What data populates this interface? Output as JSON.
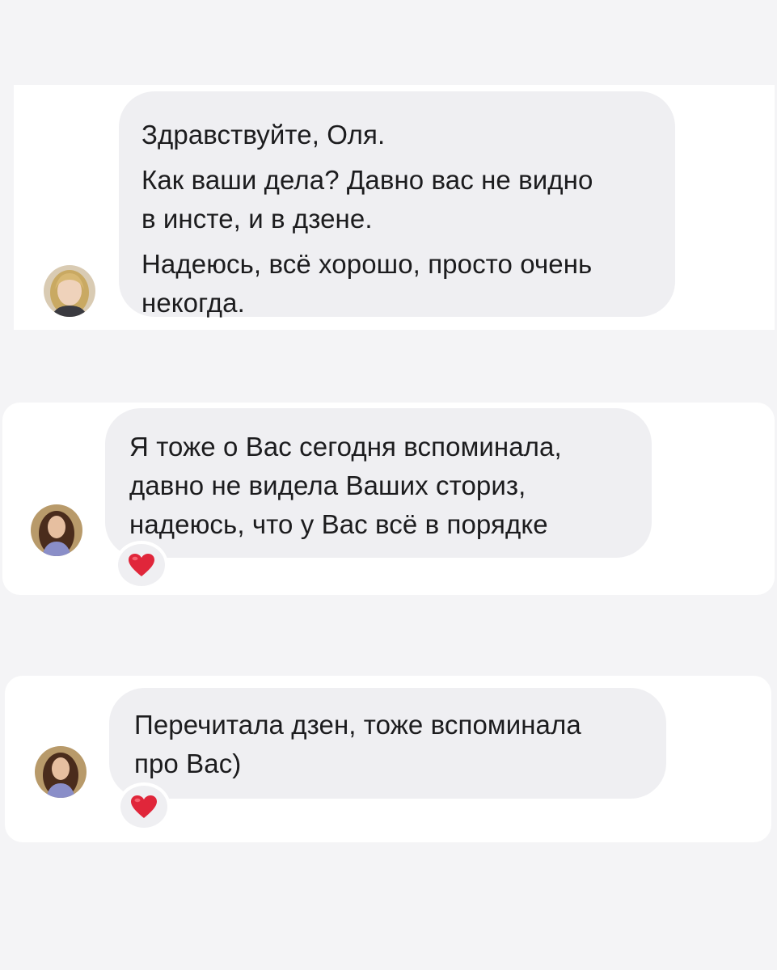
{
  "messages": [
    {
      "id": "msg1",
      "sender": "contact",
      "lines": [
        [
          "Здравствуйте, Оля."
        ],
        [
          "Как ваши дела? Давно вас не видно",
          "в инсте, и в дзене."
        ],
        [
          "Надеюсь, всё хорошо, просто очень",
          "некогда."
        ]
      ],
      "reaction": null
    },
    {
      "id": "msg2",
      "sender": "self",
      "lines": [
        [
          "Я тоже о Вас сегодня вспоминала,",
          "давно не видела Ваших сториз,",
          "надеюсь, что у Вас всё в порядке"
        ]
      ],
      "reaction": "red-heart"
    },
    {
      "id": "msg3",
      "sender": "self",
      "lines": [
        [
          "Перечитала дзен, тоже вспоминала",
          "про Вас)"
        ]
      ],
      "reaction": "red-heart"
    }
  ],
  "colors": {
    "page_background": "#f4f4f6",
    "card_background": "#ffffff",
    "bubble_background": "#efeff2",
    "text": "#1c1c1e",
    "heart": "#e0263a"
  },
  "icons": {
    "reaction": "red-heart-icon",
    "avatar_contact": "blonde-woman-avatar",
    "avatar_self": "brunette-woman-avatar"
  }
}
